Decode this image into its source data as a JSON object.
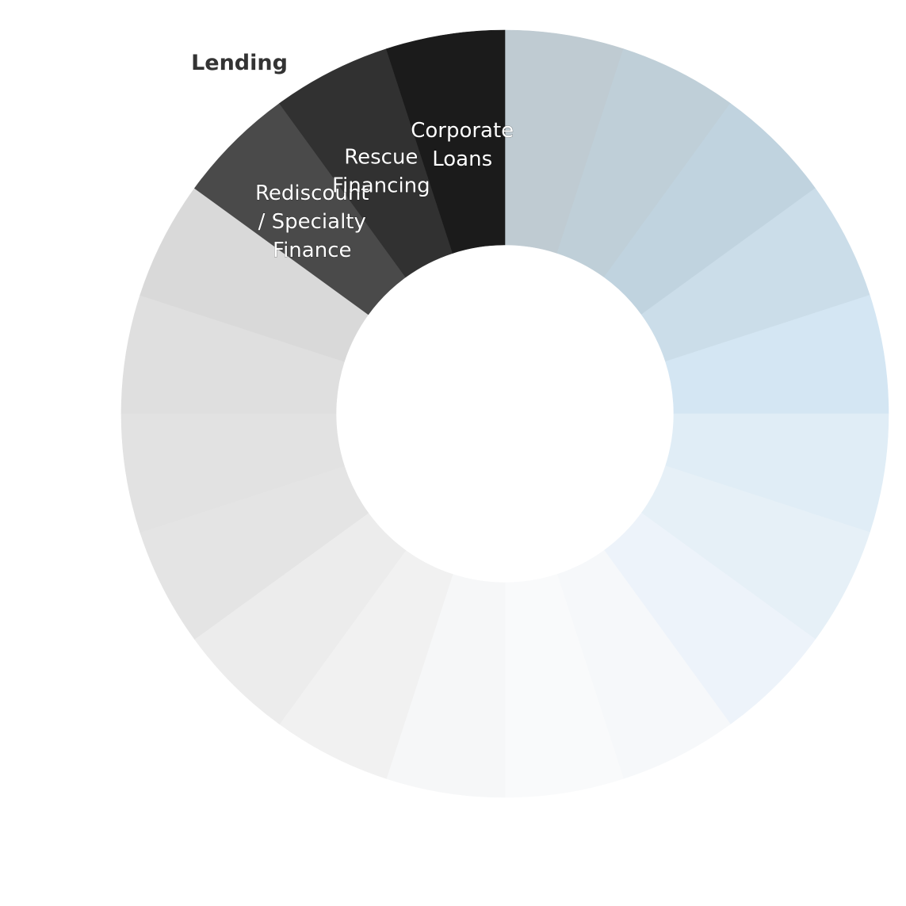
{
  "chart_data": {
    "type": "pie",
    "variant": "donut",
    "title": "",
    "start_angle": "12 o'clock",
    "direction": "clockwise",
    "groups": [
      {
        "name": "Lending",
        "label_visible": true
      }
    ],
    "segments": [
      {
        "name": "",
        "value": 1,
        "color": "#bfcbd2"
      },
      {
        "name": "",
        "value": 1,
        "color": "#bfcfd8"
      },
      {
        "name": "",
        "value": 1,
        "color": "#c0d3df"
      },
      {
        "name": "",
        "value": 1,
        "color": "#cbdde9"
      },
      {
        "name": "",
        "value": 1,
        "color": "#d4e6f3"
      },
      {
        "name": "",
        "value": 1,
        "color": "#e0edf6"
      },
      {
        "name": "",
        "value": 1,
        "color": "#e6f0f7"
      },
      {
        "name": "",
        "value": 1,
        "color": "#edf3fa"
      },
      {
        "name": "",
        "value": 1,
        "color": "#f6f8fa"
      },
      {
        "name": "",
        "value": 1,
        "color": "#f9fafb"
      },
      {
        "name": "",
        "value": 1,
        "color": "#f6f7f8"
      },
      {
        "name": "",
        "value": 1,
        "color": "#f1f1f1"
      },
      {
        "name": "",
        "value": 1,
        "color": "#ececec"
      },
      {
        "name": "",
        "value": 1,
        "color": "#e4e4e4"
      },
      {
        "name": "",
        "value": 1,
        "color": "#e2e2e2"
      },
      {
        "name": "",
        "value": 1,
        "color": "#dfdfdf"
      },
      {
        "name": "",
        "value": 1,
        "color": "#d9d9d9"
      },
      {
        "name": "Rediscount / Specialty Finance",
        "lines": [
          "Rediscount",
          "/ Specialty",
          "Finance"
        ],
        "value": 1,
        "color": "#4a4a4a",
        "group": "Lending"
      },
      {
        "name": "Rescue Financing",
        "lines": [
          "Rescue",
          "Financing"
        ],
        "value": 1,
        "color": "#313131",
        "group": "Lending"
      },
      {
        "name": "Corporate Loans",
        "lines": [
          "Corporate",
          "Loans"
        ],
        "value": 1,
        "color": "#1b1b1b",
        "group": "Lending"
      }
    ],
    "legend": "none"
  }
}
